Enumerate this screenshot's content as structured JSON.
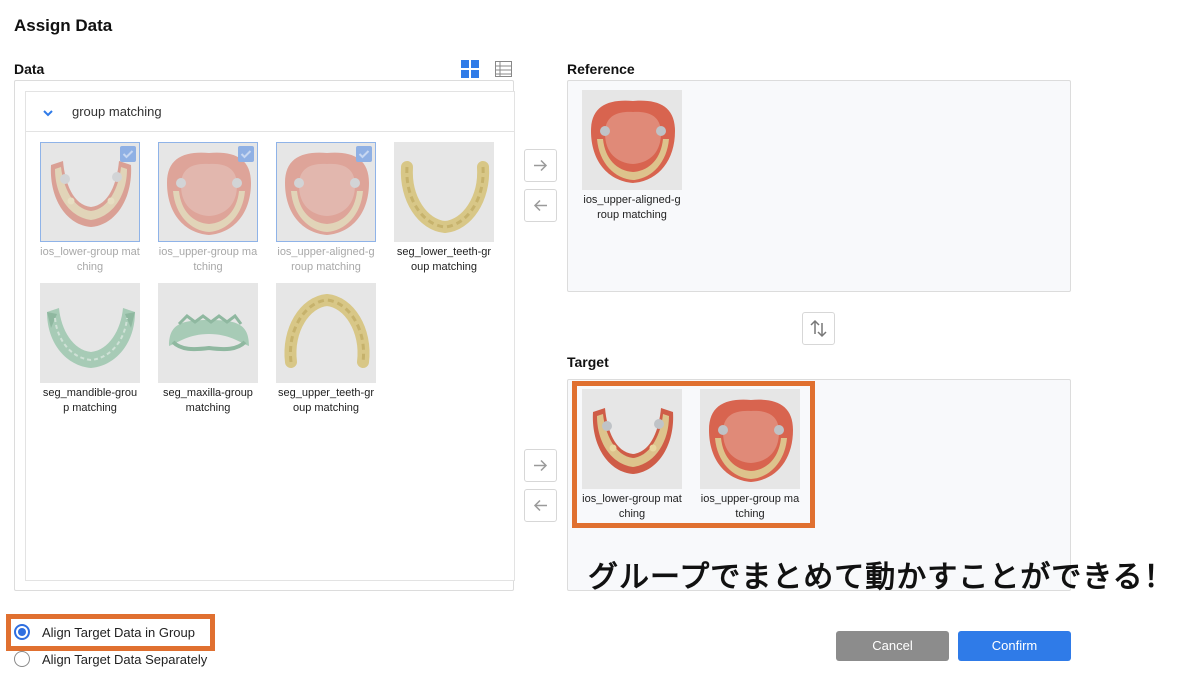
{
  "dialog": {
    "title": "Assign Data"
  },
  "data_panel": {
    "label": "Data",
    "group_name": "group matching",
    "items": [
      {
        "label": "ios_lower-group matching",
        "selected": true,
        "icon": "lower-jaw-scan"
      },
      {
        "label": "ios_upper-group matching",
        "selected": true,
        "icon": "upper-jaw-scan"
      },
      {
        "label": "ios_upper-aligned-group matching",
        "selected": true,
        "icon": "upper-jaw-scan"
      },
      {
        "label": "seg_lower_teeth-group matching",
        "selected": false,
        "icon": "lower-teeth-segment"
      },
      {
        "label": "seg_mandible-group matching",
        "selected": false,
        "icon": "mandible-segment"
      },
      {
        "label": "seg_maxilla-group matching",
        "selected": false,
        "icon": "maxilla-segment"
      },
      {
        "label": "seg_upper_teeth-group matching",
        "selected": false,
        "icon": "upper-teeth-segment"
      }
    ]
  },
  "reference_panel": {
    "label": "Reference",
    "items": [
      {
        "label": "ios_upper-aligned-group matching",
        "icon": "upper-jaw-scan"
      }
    ]
  },
  "target_panel": {
    "label": "Target",
    "items": [
      {
        "label": "ios_lower-group matching",
        "icon": "lower-jaw-scan"
      },
      {
        "label": "ios_upper-group matching",
        "icon": "upper-jaw-scan"
      }
    ]
  },
  "annotation": {
    "text": "グループでまとめて動かすことができる！",
    "highlight_color": "#e07030"
  },
  "options": {
    "align_group": {
      "label": "Align Target Data in Group",
      "checked": true
    },
    "align_separate": {
      "label": "Align Target Data Separately",
      "checked": false
    }
  },
  "buttons": {
    "cancel": "Cancel",
    "confirm": "Confirm"
  },
  "colors": {
    "accent": "#2f7be8",
    "cancel": "#8c8c8c",
    "gum": "#d8644f",
    "teeth": "#d9c98a",
    "bone": "#a9cbb8"
  }
}
